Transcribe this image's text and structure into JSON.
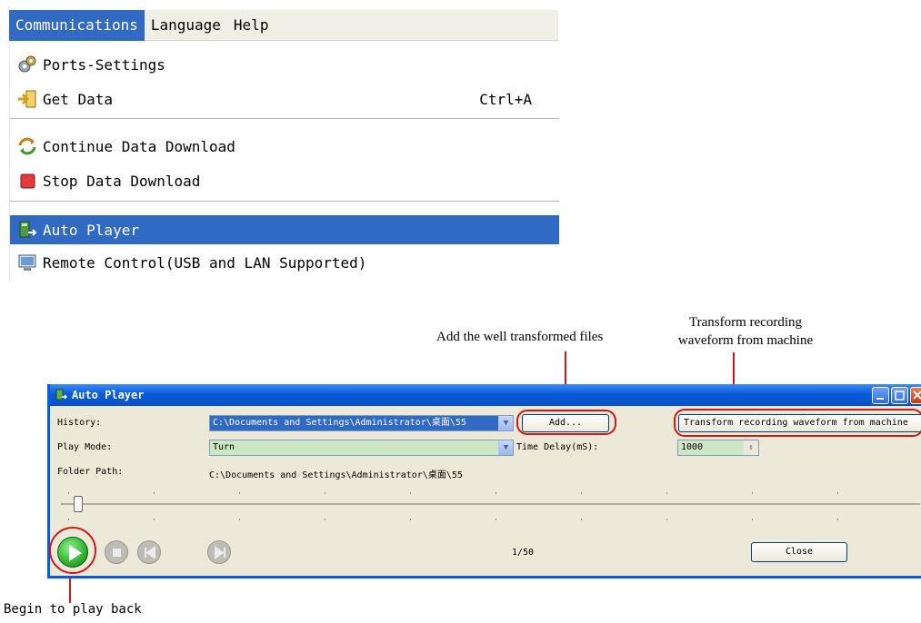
{
  "menubar": {
    "items": [
      "Communications",
      "Language",
      "Help"
    ]
  },
  "menu": {
    "items": [
      {
        "icon": "ports-settings-icon",
        "label": "Ports-Settings",
        "shortcut": ""
      },
      {
        "icon": "get-data-icon",
        "label": "Get Data",
        "shortcut": "Ctrl+A"
      },
      {
        "icon": "continue-download-icon",
        "label": "Continue Data Download",
        "shortcut": ""
      },
      {
        "icon": "stop-download-icon",
        "label": "Stop Data Download",
        "shortcut": ""
      },
      {
        "icon": "auto-player-icon",
        "label": "Auto Player",
        "shortcut": "",
        "highlighted": true
      },
      {
        "icon": "remote-control-icon",
        "label": "Remote Control(USB and LAN Supported)",
        "shortcut": ""
      }
    ]
  },
  "annotations": {
    "add_files": "Add the well transformed files",
    "transform_line1": "Transform recording",
    "transform_line2": "waveform from machine",
    "begin": "Begin to play back"
  },
  "window": {
    "title": "Auto Player",
    "history_label": "History:",
    "history_value": "C:\\Documents and Settings\\Administrator\\桌面\\55",
    "add_button": "Add...",
    "transform_button": "Transform recording waveform from machine",
    "play_mode_label": "Play Mode:",
    "play_mode_value": "Turn",
    "time_delay_label": "Time Delay(mS):",
    "time_delay_value": "1000",
    "folder_path_label": "Folder Path:",
    "folder_path_value": "C:\\Documents and Settings\\Administrator\\桌面\\55",
    "counter": "1/50",
    "close_button": "Close",
    "slider_position": 0.02
  },
  "colors": {
    "menu_highlight": "#316ac5",
    "title_bar": "#0a5bd9",
    "annotation_red": "#d01818",
    "play_green": "#2fb32f"
  }
}
